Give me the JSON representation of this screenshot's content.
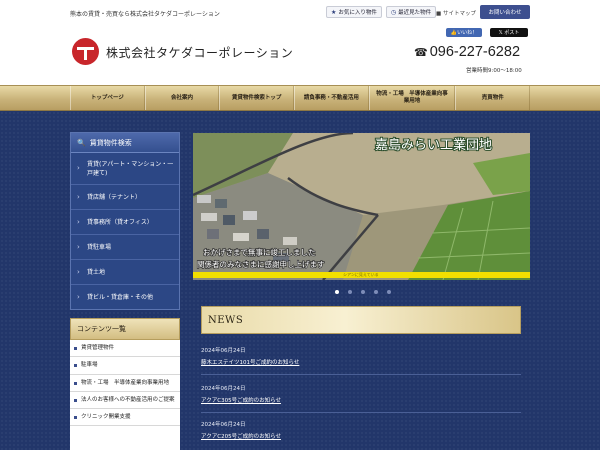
{
  "header": {
    "tagline": "熊本の賃貸・売買なら株式会社タケダコーポレーション",
    "favorites_label": "お気に入り物件",
    "recent_label": "最近見た物件",
    "sitemap_label": "サイトマップ",
    "contact_label": "お問い合わせ",
    "company_name": "株式会社タケダコーポレーション",
    "like_label": "いいね！",
    "post_label": "ポスト",
    "phone": "096-227-6282",
    "hours": "営業時間9:00～18:00"
  },
  "nav": {
    "items": [
      {
        "label": "トップページ"
      },
      {
        "label": "会社案内"
      },
      {
        "label": "賃貸物件検索トップ"
      },
      {
        "label": "請負事務・不動産活用"
      },
      {
        "label": "物流・工場　半導体産業向事業用地"
      },
      {
        "label": "売買物件"
      }
    ]
  },
  "sidebar": {
    "title": "賃貸物件検索",
    "items": [
      {
        "label": "賃貸(アパート・マンション・一戸建て)"
      },
      {
        "label": "貸店舗（テナント）"
      },
      {
        "label": "貸事務所（貸オフィス）"
      },
      {
        "label": "貸駐車場"
      },
      {
        "label": "貸土地"
      },
      {
        "label": "貸ビル・貸倉庫・その他"
      }
    ]
  },
  "contents": {
    "title": "コンテンツ一覧",
    "items": [
      {
        "label": "賃貸管理物件"
      },
      {
        "label": "駐車場"
      },
      {
        "label": "物流・工場　半導体産業向事業用地"
      },
      {
        "label": "法人のお客様への不動産活用のご提案"
      },
      {
        "label": "クリニック開業支援"
      }
    ]
  },
  "slider": {
    "title": "嘉島みらい工業団地",
    "caption1": "おかげさまで無事に竣工しました",
    "caption2": "関係者のみなさまに感謝申し上げます",
    "small_caption": "シアンに見えている",
    "dot_count": 5,
    "active_index": 0
  },
  "news": {
    "title": "NEWS",
    "items": [
      {
        "date": "2024年06月24日",
        "link": "藤木エステイツ101号ご成約のお知らせ"
      },
      {
        "date": "2024年06月24日",
        "link": "アクアC305号ご成約のお知らせ"
      },
      {
        "date": "2024年06月24日",
        "link": "アクアC205号ご成約のお知らせ"
      }
    ]
  },
  "colors": {
    "brand_red": "#c8262b",
    "navy": "#22366a",
    "gold": "#c9b37a",
    "slider_yellow": "#f2df00"
  }
}
